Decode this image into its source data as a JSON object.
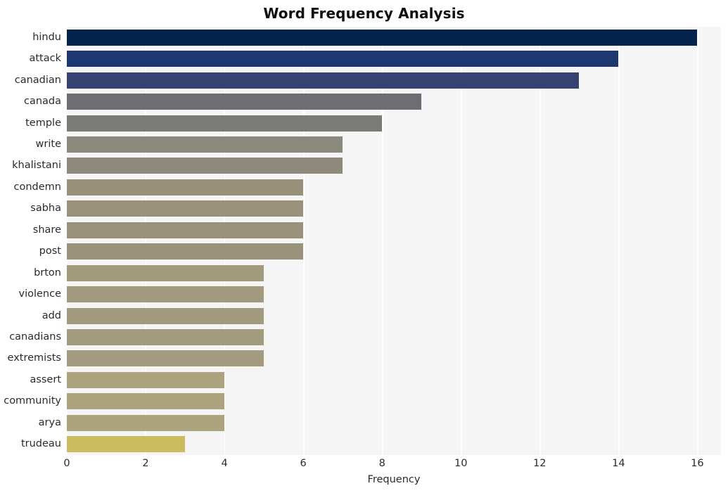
{
  "chart_data": {
    "type": "bar",
    "orientation": "horizontal",
    "title": "Word Frequency Analysis",
    "xlabel": "Frequency",
    "ylabel": "",
    "xlim": [
      0,
      16.6
    ],
    "ylim": [
      0,
      20
    ],
    "xticks": [
      0,
      2,
      4,
      6,
      8,
      10,
      12,
      14,
      16
    ],
    "xtick_labels": [
      "0",
      "2",
      "4",
      "6",
      "8",
      "10",
      "12",
      "14",
      "16"
    ],
    "grid": "vertical-white-on-gray",
    "legend": "none",
    "categories": [
      "hindu",
      "attack",
      "canadian",
      "canada",
      "temple",
      "write",
      "khalistani",
      "condemn",
      "sabha",
      "share",
      "post",
      "brton",
      "violence",
      "add",
      "canadians",
      "extremists",
      "assert",
      "community",
      "arya",
      "trudeau"
    ],
    "values": [
      16,
      14,
      13,
      9,
      8,
      7,
      7,
      6,
      6,
      6,
      6,
      5,
      5,
      5,
      5,
      5,
      4,
      4,
      4,
      3
    ],
    "bar_colors": [
      "#05234d",
      "#1d3770",
      "#344372",
      "#6c6e73",
      "#7b7a76",
      "#8b897c",
      "#8d8a7b",
      "#97917a",
      "#98927b",
      "#98927b",
      "#98927b",
      "#a29a7c",
      "#a29a7c",
      "#a29a7c",
      "#a39b7d",
      "#a39b7d",
      "#aca37e",
      "#aca37e",
      "#ada47e",
      "#cbbd5f"
    ],
    "plot_background": "#f5f5f6",
    "figure_background": "#ffffff",
    "tick_color": "#2b2b2b"
  }
}
